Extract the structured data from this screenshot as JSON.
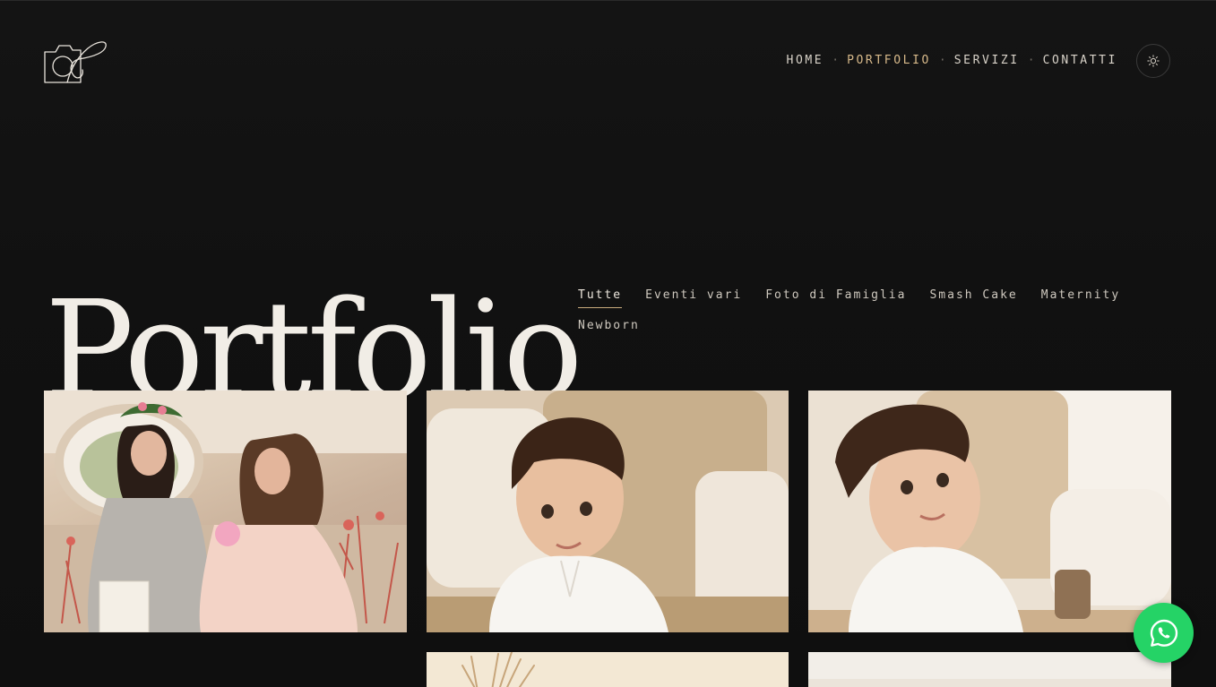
{
  "header": {
    "logo_icon": "camera-signature-logo",
    "nav": [
      {
        "label": "HOME",
        "active": false
      },
      {
        "label": "PORTFOLIO",
        "active": true
      },
      {
        "label": "SERVIZI",
        "active": false
      },
      {
        "label": "CONTATTI",
        "active": false
      }
    ],
    "nav_separator": "·",
    "theme_toggle_icon": "sun-icon"
  },
  "page": {
    "title": "Portfolio"
  },
  "filters": [
    {
      "label": "Tutte",
      "active": true
    },
    {
      "label": "Eventi vari",
      "active": false
    },
    {
      "label": "Foto di Famiglia",
      "active": false
    },
    {
      "label": "Smash Cake",
      "active": false
    },
    {
      "label": "Maternity",
      "active": false
    },
    {
      "label": "Newborn",
      "active": false
    }
  ],
  "gallery": [
    {
      "subject": "graduation-mother-daughter-photo"
    },
    {
      "subject": "toddler-portrait-photo"
    },
    {
      "subject": "toddler-portrait-photo-2"
    },
    {
      "subject": "pampas-grass-photo"
    },
    {
      "subject": "light-background-photo"
    }
  ],
  "colors": {
    "background": "#121212",
    "accent": "#d7b98a",
    "text": "#e9e4dc",
    "whatsapp": "#25d366"
  },
  "floating": {
    "whatsapp_icon": "whatsapp-icon"
  }
}
